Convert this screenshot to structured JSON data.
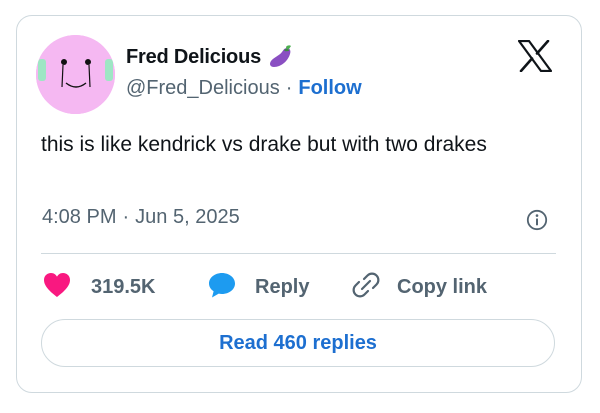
{
  "author": {
    "display_name": "Fred Delicious",
    "handle": "@Fred_Delicious",
    "separator": "·",
    "follow_label": "Follow",
    "name_emoji_icon": "eggplant-icon",
    "avatar_color": "#f5b8f2"
  },
  "tweet": {
    "text": "this is like kendrick vs drake but with two drakes",
    "time": "4:08 PM",
    "separator": "·",
    "date": "Jun 5, 2025"
  },
  "actions": {
    "like_count": "319.5K",
    "reply_label": "Reply",
    "copy_link_label": "Copy link"
  },
  "read_replies_label": "Read 460 replies",
  "colors": {
    "like": "#f91880",
    "reply": "#1d9bf0",
    "link": "#1d6fd0",
    "muted": "#536471",
    "border": "#cfd9de"
  }
}
